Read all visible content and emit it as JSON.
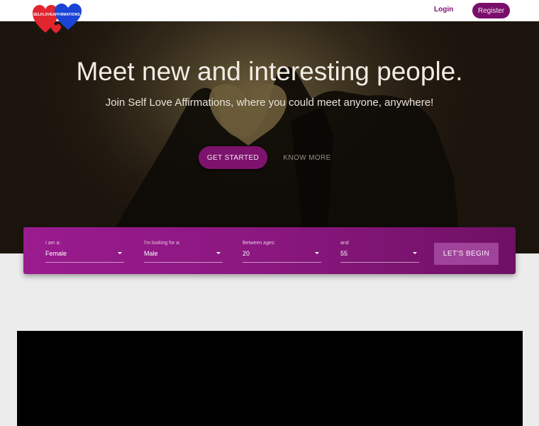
{
  "header": {
    "logo_text": "SELFLOVEAFFIRMATIONS.NET",
    "login_label": "Login",
    "register_label": "Register"
  },
  "hero": {
    "title": "Meet new and interesting people.",
    "subtitle": "Join Self Love Affirmations, where you could meet anyone, anywhere!",
    "get_started_label": "GET STARTED",
    "know_more_label": "KNOW MORE"
  },
  "search": {
    "fields": [
      {
        "label": "I am a:",
        "value": "Female"
      },
      {
        "label": "I'm looking for a:",
        "value": "Male"
      },
      {
        "label": "Between ages:",
        "value": "20"
      },
      {
        "label": "and",
        "value": "55"
      }
    ],
    "submit_label": "LET'S BEGIN"
  },
  "colors": {
    "brand_purple": "#7a0f6b",
    "panel_purple": "#9a1b8e",
    "heart_red": "#e0252f",
    "heart_blue": "#1a44d6"
  }
}
